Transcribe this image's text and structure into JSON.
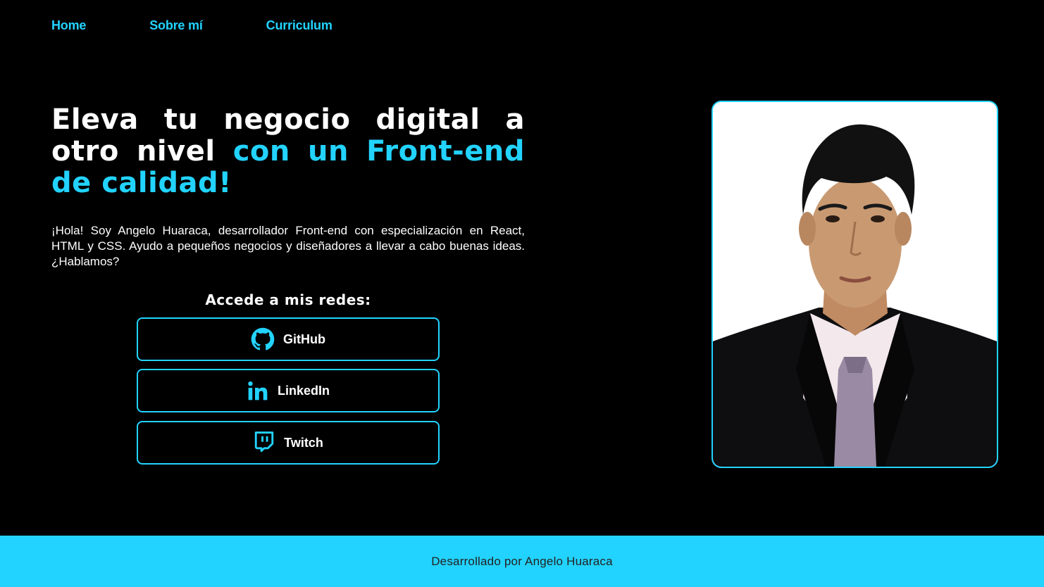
{
  "nav": {
    "items": [
      {
        "label": "Home"
      },
      {
        "label": "Sobre mí"
      },
      {
        "label": "Curriculum"
      }
    ]
  },
  "hero": {
    "title_part1": "Eleva tu negocio digital a otro nivel ",
    "title_accent": "con un Front-end de calidad!",
    "intro": "¡Hola! Soy Angelo Huaraca, desarrollador Front-end con especialización en React, HTML y CSS. Ayudo a pequeños negocios y diseñadores a llevar a cabo buenas ideas. ¿Hablamos?"
  },
  "social": {
    "heading": "Accede a mis redes:",
    "buttons": [
      {
        "label": "GitHub",
        "icon": "github-icon"
      },
      {
        "label": "LinkedIn",
        "icon": "linkedin-icon"
      },
      {
        "label": "Twitch",
        "icon": "twitch-icon"
      }
    ]
  },
  "profile": {
    "photo": "profile-photo"
  },
  "footer": {
    "text": "Desarrollado por Angelo Huaraca"
  },
  "colors": {
    "accent": "#22d3ff",
    "background": "#000000",
    "text": "#ffffff",
    "footer_text": "#222222"
  }
}
